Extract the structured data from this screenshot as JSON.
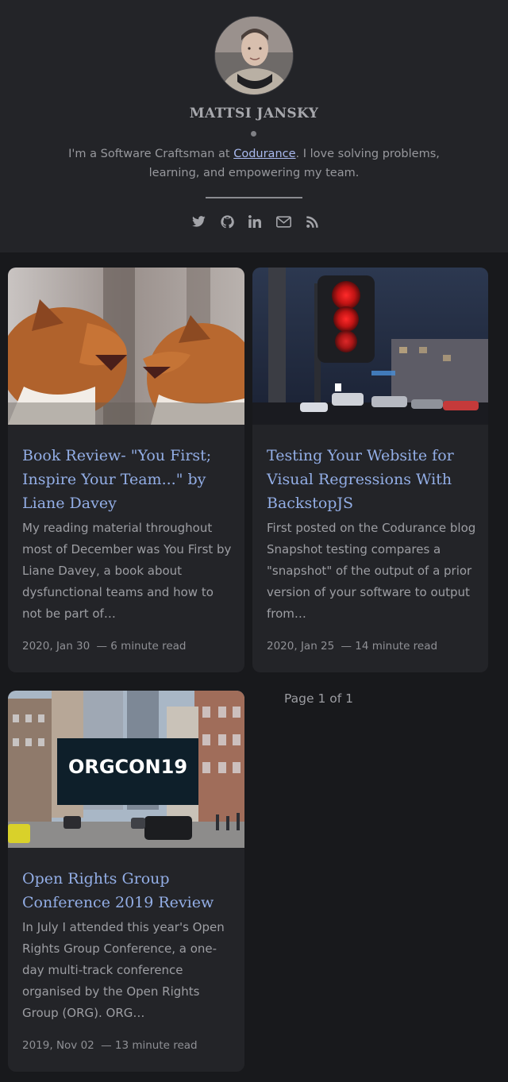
{
  "site": {
    "title": "MATTSI JANSKY",
    "bio_prefix": "I'm a Software Craftsman at ",
    "bio_link": "Codurance",
    "bio_suffix": ". I love solving problems, learning, and empowering my team.",
    "socials": [
      "twitter-icon",
      "github-icon",
      "linkedin-icon",
      "email-icon",
      "rss-icon"
    ]
  },
  "posts": [
    {
      "title": "Book Review- \"You First; Inspire Your Team...\" by Liane Davey",
      "excerpt": "My reading material throughout most of December was You First by Liane Davey, a book about dysfunctional teams and how to not be part of…",
      "date": "2020, Jan 30",
      "read_time": "— 6 minute read",
      "image": "two-foxes-photo"
    },
    {
      "title": "Testing Your Website for Visual Regressions With BackstopJS",
      "excerpt": "First posted on the Codurance blog Snapshot testing compares a \"snapshot\" of the output of a prior version of your software to output from…",
      "date": "2020, Jan 25",
      "read_time": "— 14 minute read",
      "image": "traffic-light-photo"
    },
    {
      "title": "Open Rights Group Conference 2019 Review",
      "excerpt": "In July I attended this year's Open Rights Group Conference, a one-day multi-track conference organised by the Open Rights Group (ORG). ORG…",
      "date": "2019, Nov 02",
      "read_time": "— 13 minute read",
      "image": "orgcon-street-photo",
      "image_text": "ORGCON19"
    }
  ],
  "pagination": {
    "label": "Page 1 of 1"
  }
}
